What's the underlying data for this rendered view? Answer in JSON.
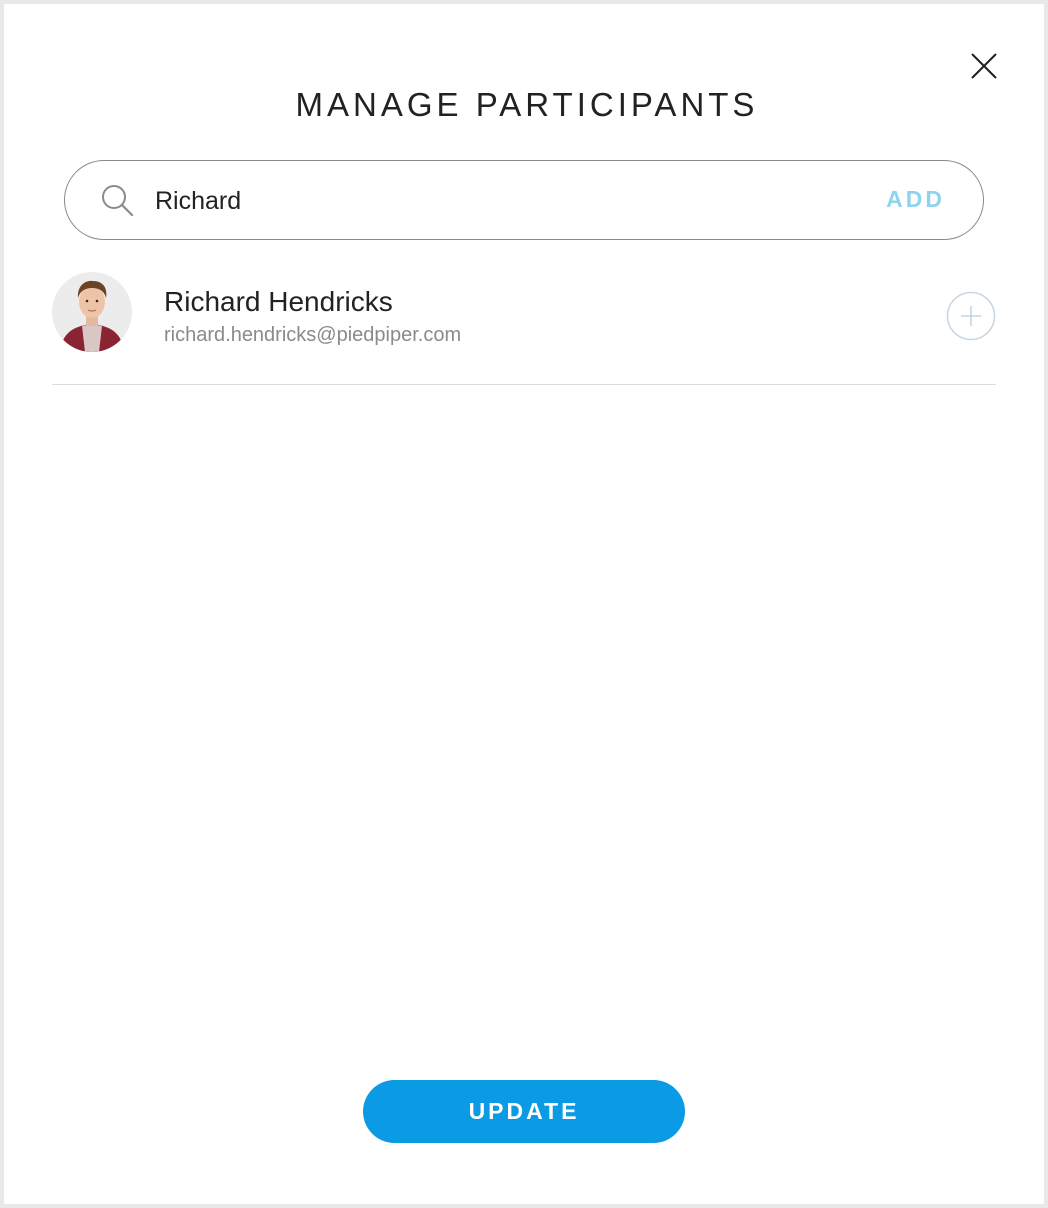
{
  "dialog": {
    "title": "MANAGE PARTICIPANTS",
    "close_icon": "close-icon"
  },
  "search": {
    "icon": "search-icon",
    "value": "Richard",
    "add_label": "ADD",
    "add_color": "#8fd3ee"
  },
  "results": [
    {
      "name": "Richard Hendricks",
      "email": "richard.hendricks@piedpiper.com",
      "avatar": "avatar-photo",
      "action_icon": "plus-circle-icon"
    }
  ],
  "footer": {
    "update_label": "UPDATE",
    "update_color": "#0a9be4"
  }
}
